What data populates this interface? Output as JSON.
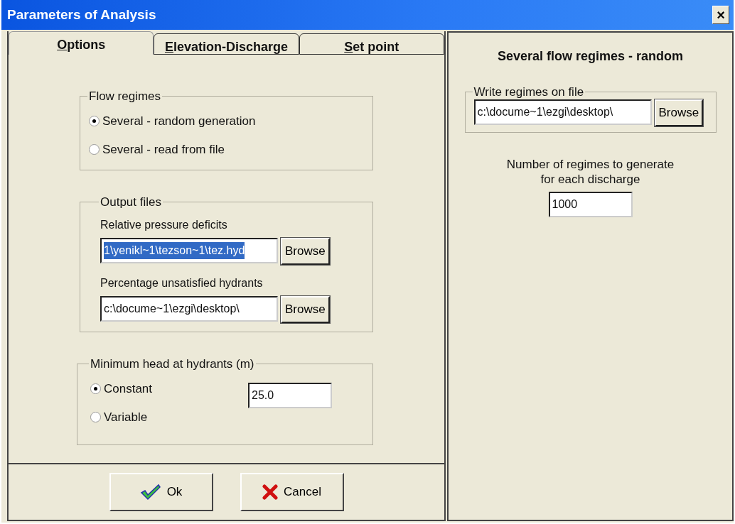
{
  "window": {
    "title": "Parameters of Analysis",
    "close": "×"
  },
  "tabs": [
    {
      "label": "Options",
      "mnemonic": true,
      "selected": true
    },
    {
      "label": "Elevation-Discharge",
      "mnemonic": true,
      "selected": false
    },
    {
      "label": "Set point",
      "mnemonic": true,
      "selected": false
    }
  ],
  "flow_regimes": {
    "legend": "Flow regimes",
    "options": [
      {
        "label": "Several - random generation",
        "selected": true
      },
      {
        "label": "Several - read from file",
        "selected": false
      }
    ]
  },
  "output_files": {
    "legend": "Output files",
    "files": [
      {
        "label": "Relative pressure deficits",
        "value": "1\\yenikl~1\\tezson~1\\tez.hyd",
        "highlighted": true,
        "button": "Browse"
      },
      {
        "label": "Percentage unsatisfied hydrants",
        "value": "c:\\docume~1\\ezgi\\desktop\\",
        "highlighted": false,
        "button": "Browse"
      }
    ]
  },
  "minimum_head": {
    "legend": "Minimum head at hydrants (m)",
    "options": [
      {
        "label": "Constant",
        "selected": true
      },
      {
        "label": "Variable",
        "selected": false
      }
    ],
    "value": "25.0"
  },
  "buttons": [
    {
      "kind": "ok",
      "label": "Ok"
    },
    {
      "kind": "cancel",
      "label": "Cancel"
    }
  ],
  "right_panel": {
    "title": "Several flow regimes - random",
    "write_group": {
      "legend": "Write regimes on file",
      "value": "c:\\docume~1\\ezgi\\desktop\\",
      "button": "Browse"
    },
    "count_label": "Number of regimes to generate\nfor each discharge",
    "count_value": "1000"
  }
}
